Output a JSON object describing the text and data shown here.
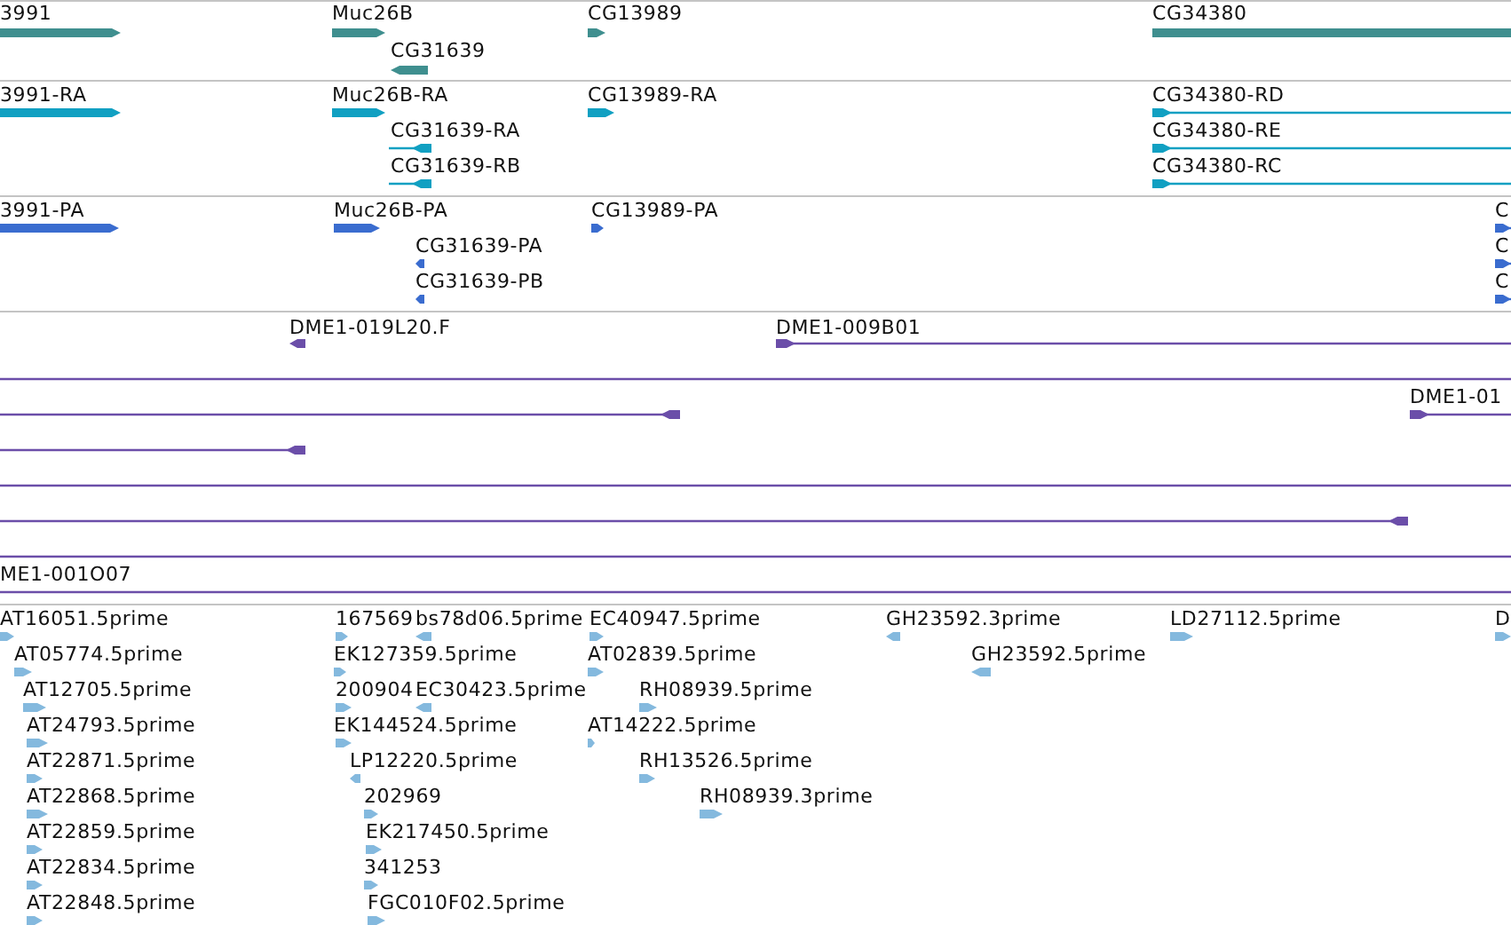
{
  "tracks": [
    {
      "kind": "gene",
      "features": [
        {
          "label": "3991",
          "kind": "block",
          "reverse": false
        },
        {
          "label": "Muc26B",
          "kind": "block",
          "reverse": false
        },
        {
          "label": "CG31639",
          "kind": "block",
          "reverse": true
        },
        {
          "label": "CG13989",
          "kind": "block",
          "reverse": false
        },
        {
          "label": "CG34380",
          "kind": "block",
          "reverse": false
        }
      ]
    },
    {
      "kind": "transcript",
      "features": [
        {
          "label": "3991-RA",
          "kind": "block",
          "reverse": false
        },
        {
          "label": "Muc26B-RA",
          "kind": "block",
          "reverse": false
        },
        {
          "label": "CG31639-RA",
          "kind": "spliced",
          "reverse": true
        },
        {
          "label": "CG31639-RB",
          "kind": "spliced",
          "reverse": true
        },
        {
          "label": "CG13989-RA",
          "kind": "block",
          "reverse": false
        },
        {
          "label": "CG34380-RD",
          "kind": "spliced",
          "reverse": false
        },
        {
          "label": "CG34380-RE",
          "kind": "spliced",
          "reverse": false
        },
        {
          "label": "CG34380-RC",
          "kind": "spliced",
          "reverse": false
        }
      ]
    },
    {
      "kind": "protein",
      "features": [
        {
          "label": "3991-PA",
          "kind": "block",
          "reverse": false
        },
        {
          "label": "Muc26B-PA",
          "kind": "block",
          "reverse": false
        },
        {
          "label": "CG31639-PA",
          "kind": "block",
          "reverse": true
        },
        {
          "label": "CG31639-PB",
          "kind": "block",
          "reverse": true
        },
        {
          "label": "CG13989-PA",
          "kind": "block",
          "reverse": false
        },
        {
          "label": "C",
          "kind": "spliced",
          "reverse": false
        },
        {
          "label": "C",
          "kind": "spliced",
          "reverse": false
        },
        {
          "label": "C",
          "kind": "spliced",
          "reverse": false
        }
      ]
    },
    {
      "kind": "clone",
      "features": [
        {
          "label": "DME1-019L20.F",
          "kind": "block",
          "reverse": true
        },
        {
          "label": "DME1-009B01",
          "kind": "spliced",
          "reverse": false
        },
        {
          "kind": "line"
        },
        {
          "kind": "spliced",
          "reverse": true
        },
        {
          "label": "DME1-01",
          "kind": "spliced",
          "reverse": false
        },
        {
          "kind": "spliced",
          "reverse": true
        },
        {
          "kind": "line"
        },
        {
          "kind": "spliced",
          "reverse": true
        },
        {
          "kind": "line"
        },
        {
          "label": "ME1-001O07",
          "kind": "line"
        }
      ]
    },
    {
      "kind": "est",
      "features": [
        {
          "label": "AT16051.5prime",
          "kind": "block",
          "reverse": false
        },
        {
          "label": "AT05774.5prime",
          "kind": "block",
          "reverse": false
        },
        {
          "label": "AT12705.5prime",
          "kind": "block",
          "reverse": false
        },
        {
          "label": "AT24793.5prime",
          "kind": "block",
          "reverse": false
        },
        {
          "label": "AT22871.5prime",
          "kind": "block",
          "reverse": false
        },
        {
          "label": "AT22868.5prime",
          "kind": "block",
          "reverse": false
        },
        {
          "label": "AT22859.5prime",
          "kind": "block",
          "reverse": false
        },
        {
          "label": "AT22834.5prime",
          "kind": "block",
          "reverse": false
        },
        {
          "label": "AT22848.5prime",
          "kind": "block",
          "reverse": false
        },
        {
          "label": "167569",
          "kind": "block",
          "reverse": false
        },
        {
          "label": "bs78d06.5prime",
          "kind": "block",
          "reverse": true
        },
        {
          "label": "EK127359.5prime",
          "kind": "block",
          "reverse": false
        },
        {
          "label": "200904",
          "kind": "block",
          "reverse": false
        },
        {
          "label": "EC30423.5prime",
          "kind": "block",
          "reverse": true
        },
        {
          "label": "EK144524.5prime",
          "kind": "block",
          "reverse": false
        },
        {
          "label": "LP12220.5prime",
          "kind": "block",
          "reverse": true
        },
        {
          "label": "202969",
          "kind": "block",
          "reverse": false
        },
        {
          "label": "EK217450.5prime",
          "kind": "block",
          "reverse": false
        },
        {
          "label": "341253",
          "kind": "block",
          "reverse": false
        },
        {
          "label": "FGC010F02.5prime",
          "kind": "block",
          "reverse": false
        },
        {
          "label": "EC40947.5prime",
          "kind": "block",
          "reverse": false
        },
        {
          "label": "AT02839.5prime",
          "kind": "block",
          "reverse": false
        },
        {
          "label": "RH08939.5prime",
          "kind": "block",
          "reverse": false
        },
        {
          "label": "AT14222.5prime",
          "kind": "block",
          "reverse": false
        },
        {
          "label": "RH13526.5prime",
          "kind": "block",
          "reverse": false
        },
        {
          "label": "RH08939.3prime",
          "kind": "block",
          "reverse": false
        },
        {
          "label": "GH23592.3prime",
          "kind": "block",
          "reverse": true
        },
        {
          "label": "GH23592.5prime",
          "kind": "block",
          "reverse": true
        },
        {
          "label": "LD27112.5prime",
          "kind": "block",
          "reverse": false
        },
        {
          "label": "D",
          "kind": "block",
          "reverse": false
        }
      ]
    }
  ]
}
